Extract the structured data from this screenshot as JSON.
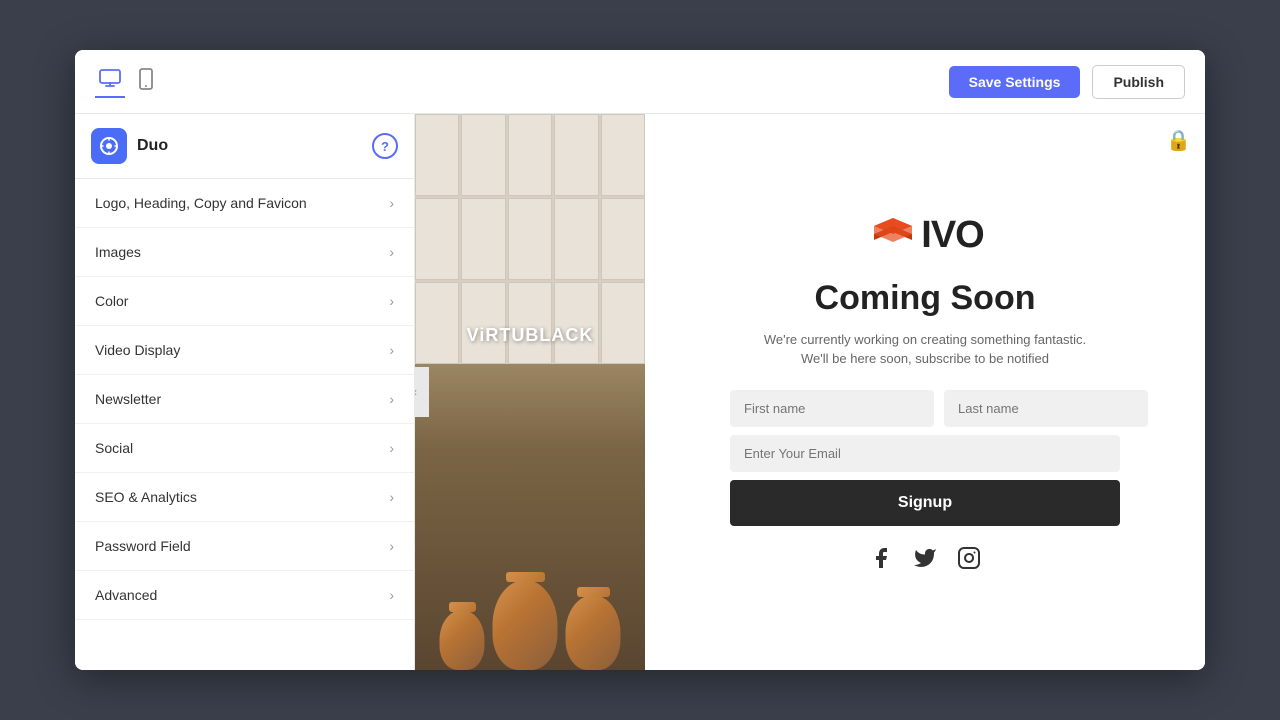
{
  "app": {
    "title": "Duo",
    "help_label": "?",
    "logo_emoji": "⚙"
  },
  "toolbar": {
    "save_label": "Save Settings",
    "publish_label": "Publish"
  },
  "sidebar": {
    "items": [
      {
        "id": "logo-heading",
        "label": "Logo, Heading, Copy and Favicon"
      },
      {
        "id": "images",
        "label": "Images"
      },
      {
        "id": "color",
        "label": "Color"
      },
      {
        "id": "video-display",
        "label": "Video Display"
      },
      {
        "id": "newsletter",
        "label": "Newsletter"
      },
      {
        "id": "social",
        "label": "Social"
      },
      {
        "id": "seo-analytics",
        "label": "SEO & Analytics"
      },
      {
        "id": "password-field",
        "label": "Password Field"
      },
      {
        "id": "advanced",
        "label": "Advanced"
      }
    ]
  },
  "preview": {
    "brand_text": "ViRTUBLACK",
    "logo_text": "IVO",
    "coming_soon_title": "Coming Soon",
    "subtitle1": "We're currently working on creating something fantastic.",
    "subtitle2": "We'll be here soon, subscribe to be notified",
    "form": {
      "first_name_placeholder": "First name",
      "last_name_placeholder": "Last name",
      "email_placeholder": "Enter Your Email",
      "signup_label": "Signup"
    },
    "social": {
      "facebook": "f",
      "twitter": "t",
      "instagram": "i"
    }
  }
}
